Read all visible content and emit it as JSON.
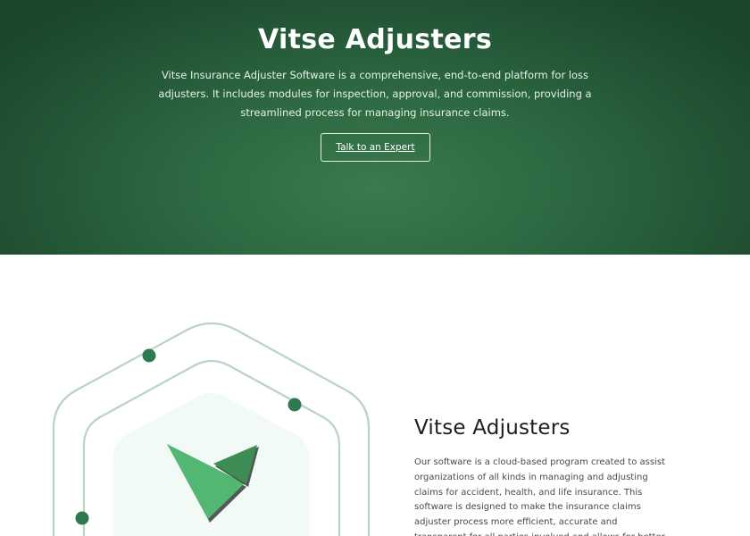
{
  "hero": {
    "title": "Vitse Adjusters",
    "description": "Vitse Insurance Adjuster Software is a comprehensive, end-to-end platform for loss adjusters. It includes modules for inspection, approval, and commission, providing a streamlined process for managing insurance claims.",
    "cta_label": "Talk to an Expert"
  },
  "section": {
    "title": "Vitse Adjusters",
    "body": "Our software is a cloud-based program created to assist organizations of all kinds in managing and adjusting claims for accident, health, and life insurance. This software is designed to make the insurance claims adjuster process more efficient, accurate and transparent for all parties involved and allows for better communication between the"
  },
  "colors": {
    "hero_bg": "#2b6640",
    "accent_dot": "#2e7a4f",
    "logo_green": "#52b773",
    "logo_dark": "#3d8c56",
    "outline": "#b9d3c5",
    "shape_fill": "#f1faf4"
  },
  "icons": {
    "logo": "vitse-v-logo-icon"
  }
}
